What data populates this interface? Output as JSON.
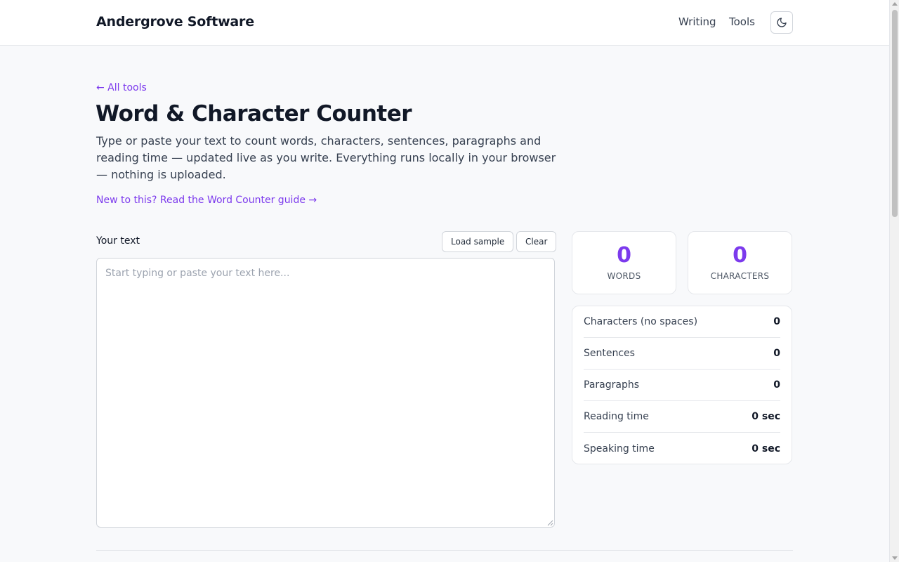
{
  "header": {
    "brand": "Andergrove Software",
    "nav": [
      "Writing",
      "Tools"
    ],
    "theme_toggle_icon": "moon-icon"
  },
  "main": {
    "back_link": "← All tools",
    "title": "Word & Character Counter",
    "lede": "Type or paste your text to count words, characters, sentences, paragraphs and reading time — updated live as you write. Everything runs locally in your browser — nothing is uploaded.",
    "guide_link": "New to this? Read the Word Counter guide →"
  },
  "editor": {
    "label": "Your text",
    "load_sample_label": "Load sample",
    "clear_label": "Clear",
    "value": "",
    "placeholder": "Start typing or paste your text here..."
  },
  "stats": {
    "words": {
      "value": "0",
      "label": "WORDS"
    },
    "characters": {
      "value": "0",
      "label": "CHARACTERS"
    },
    "details": [
      {
        "name": "Characters (no spaces)",
        "value": "0"
      },
      {
        "name": "Sentences",
        "value": "0"
      },
      {
        "name": "Paragraphs",
        "value": "0"
      },
      {
        "name": "Reading time",
        "value": "0 sec"
      },
      {
        "name": "Speaking time",
        "value": "0 sec"
      }
    ]
  },
  "colors": {
    "accent": "#7c3aed",
    "background": "#f8f9fb",
    "text": "#111827"
  }
}
